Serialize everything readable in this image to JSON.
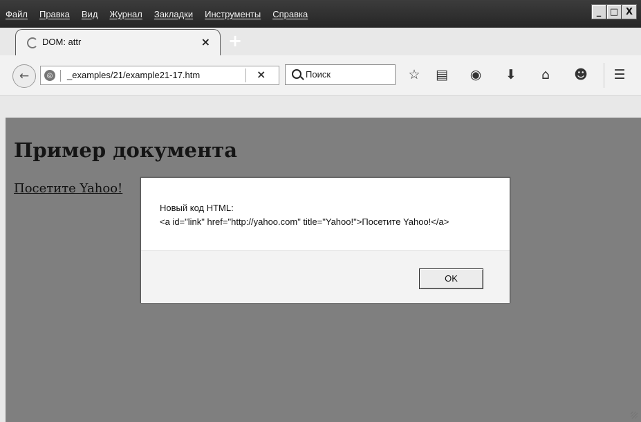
{
  "menu": [
    "Файл",
    "Правка",
    "Вид",
    "Журнал",
    "Закладки",
    "Инструменты",
    "Справка"
  ],
  "window_buttons": [
    "_",
    "□",
    "X"
  ],
  "tab": {
    "title": "DOM: attr",
    "close": "×",
    "new_tab": "+"
  },
  "navigation": {
    "url": "_examples/21/example21-17.htm",
    "stop": "×"
  },
  "search": {
    "placeholder": "Поиск"
  },
  "content": {
    "heading": "Пример документа",
    "link": "Посетите Yahoo!"
  },
  "dialog": {
    "line1": "Новый код HTML:",
    "line2": "<a id=\"link\" href=\"http://yahoo.com\" title=\"Yahoo!\">Посетите Yahoo!</a>",
    "ok_label": "OK"
  },
  "icons": {
    "toolbar": [
      "star-icon",
      "reading-list-icon",
      "pocket-icon",
      "download-icon",
      "home-icon",
      "smile-icon",
      "menu-icon"
    ]
  }
}
